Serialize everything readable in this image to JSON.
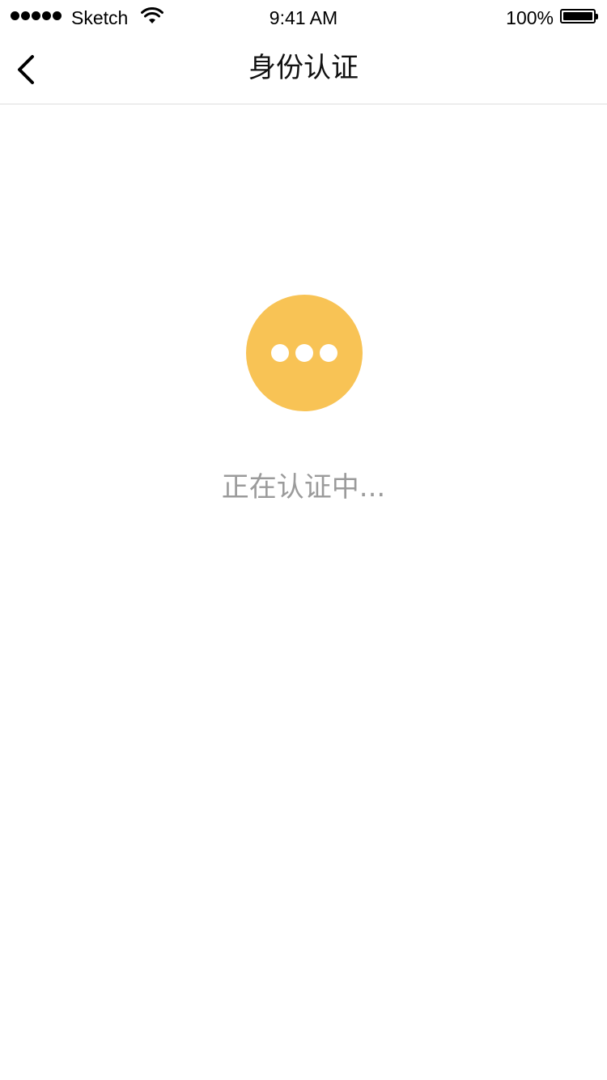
{
  "status_bar": {
    "carrier": "Sketch",
    "time": "9:41 AM",
    "battery_percent": "100%",
    "signal_icon": "signal-dots-icon",
    "wifi_icon": "wifi-icon",
    "battery_icon": "battery-full-icon"
  },
  "nav": {
    "title": "身份认证",
    "back_icon": "chevron-left-icon"
  },
  "main": {
    "status_icon": "ellipsis-circle-icon",
    "status_text": "正在认证中...",
    "accent_color": "#f8c355",
    "text_color": "#9b9b9b"
  }
}
